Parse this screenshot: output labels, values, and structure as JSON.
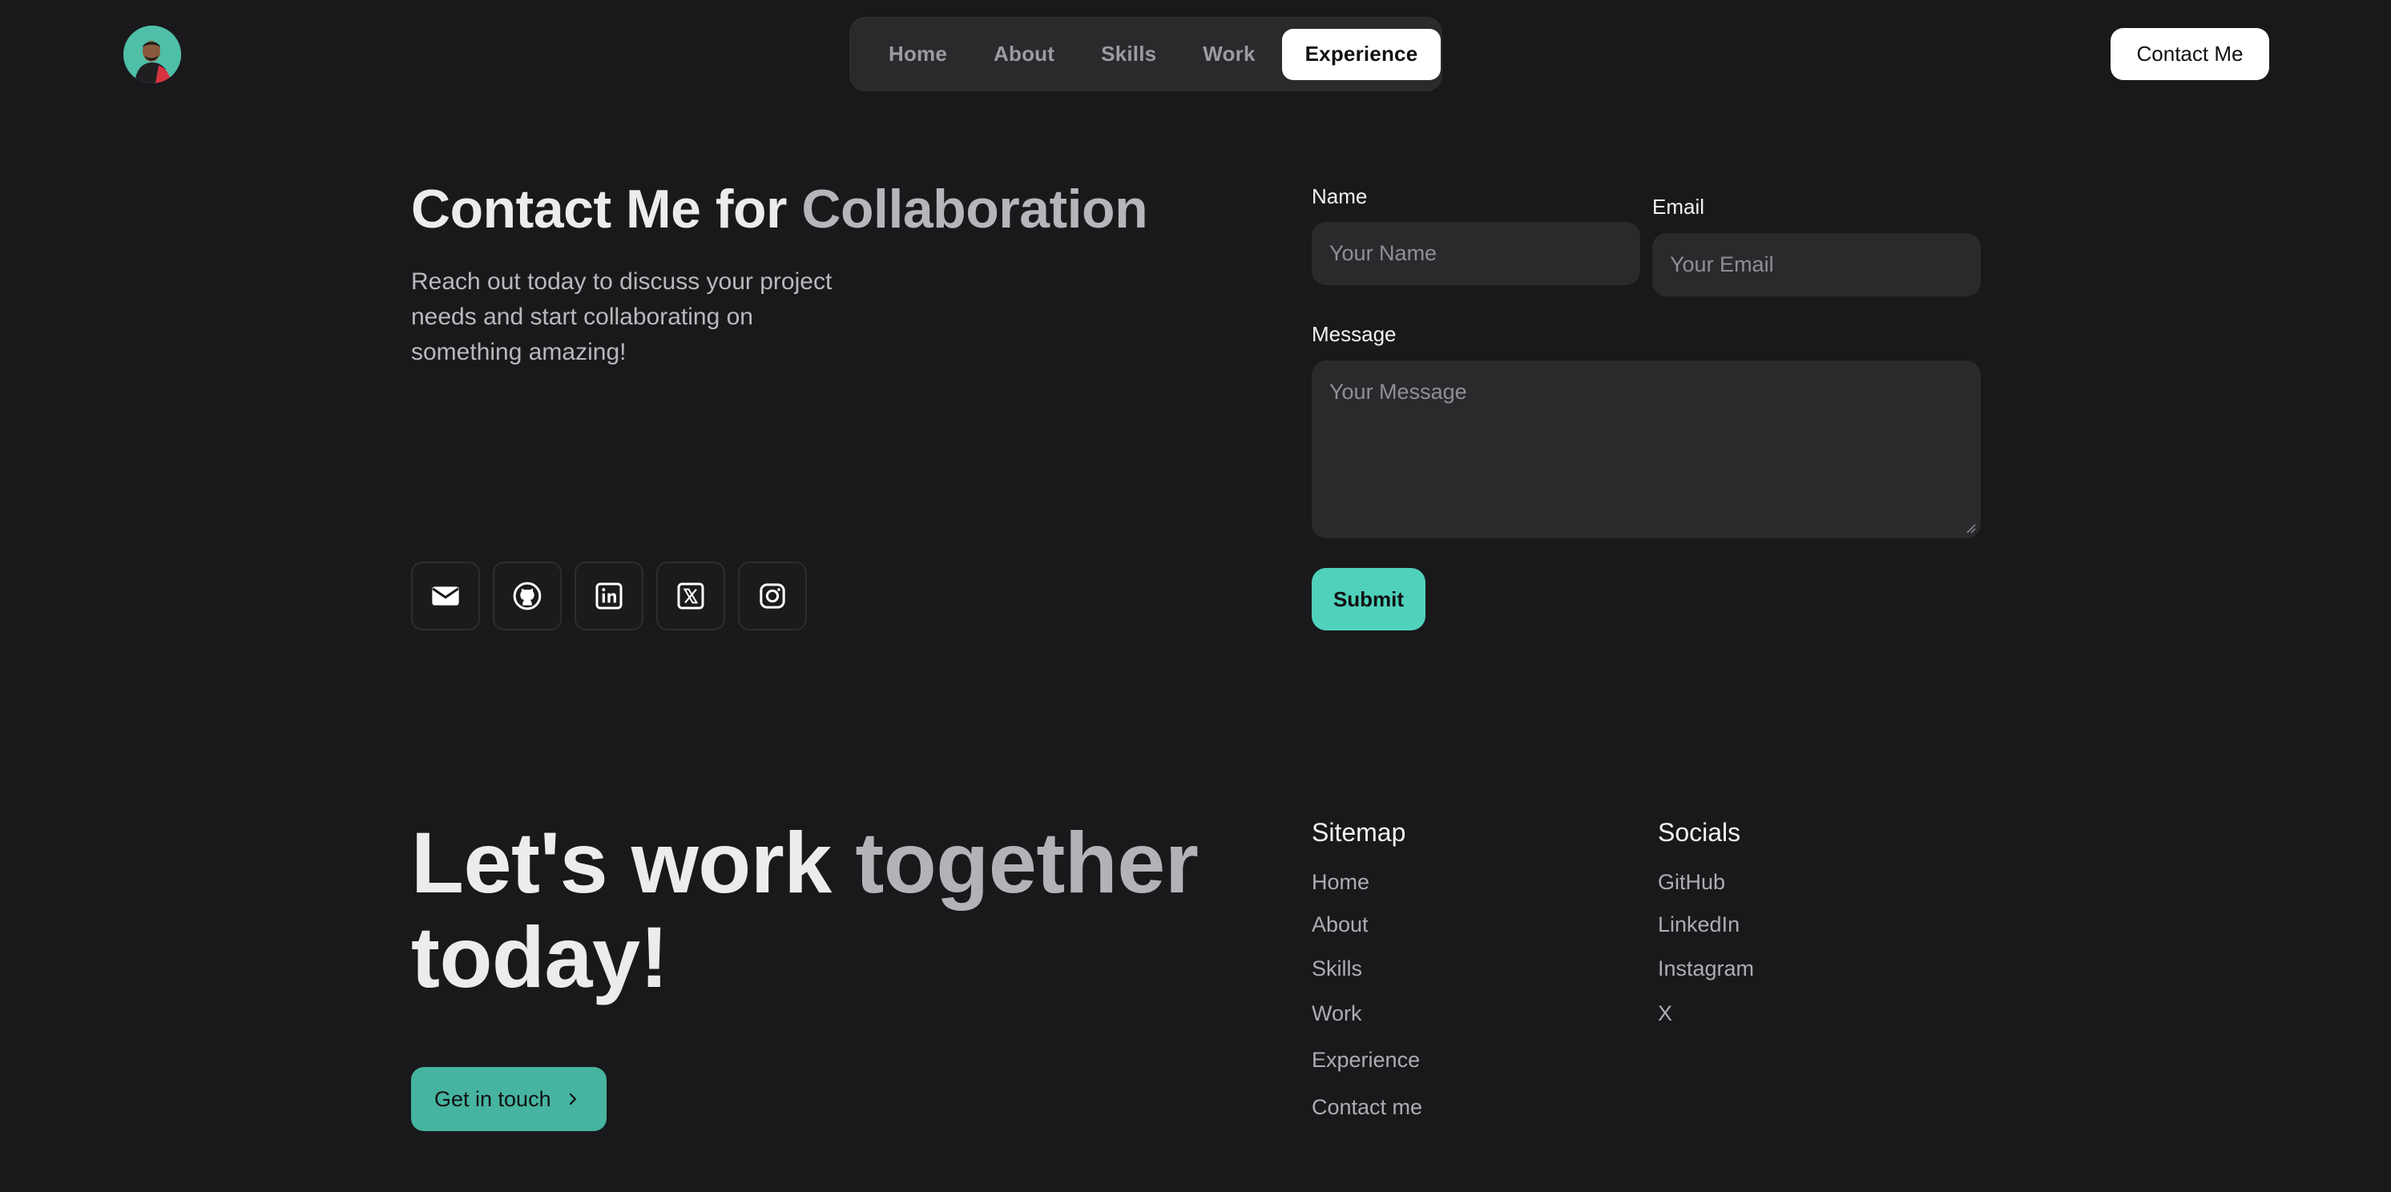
{
  "nav": {
    "items": [
      {
        "label": "Home"
      },
      {
        "label": "About"
      },
      {
        "label": "Skills"
      },
      {
        "label": "Work"
      },
      {
        "label": "Experience",
        "active": true
      }
    ],
    "contact_button": "Contact Me"
  },
  "hero": {
    "title_part1": "Contact Me for",
    "title_part2": "Collaboration",
    "subtitle": "Reach out today to discuss your project needs and start collaborating on something amazing!",
    "social_icons": [
      "mail-icon",
      "github-icon",
      "linkedin-icon",
      "x-icon",
      "instagram-icon"
    ]
  },
  "form": {
    "name_label": "Name",
    "name_placeholder": "Your Name",
    "email_label": "Email",
    "email_placeholder": "Your Email",
    "message_label": "Message",
    "message_placeholder": "Your Message",
    "submit_label": "Submit"
  },
  "footer": {
    "title_part1": "Let's work",
    "title_part2": "together",
    "title_part3": "today!",
    "cta_label": "Get in touch",
    "sitemap": {
      "heading": "Sitemap",
      "links": [
        "Home",
        "About",
        "Skills",
        "Work",
        "Experience",
        "Contact me"
      ]
    },
    "socials": {
      "heading": "Socials",
      "links": [
        "GitHub",
        "LinkedIn",
        "Instagram",
        "X"
      ]
    }
  },
  "colors": {
    "background": "#19191b",
    "accent": "#4fd1bb",
    "accent_dark": "#46b4a0"
  }
}
